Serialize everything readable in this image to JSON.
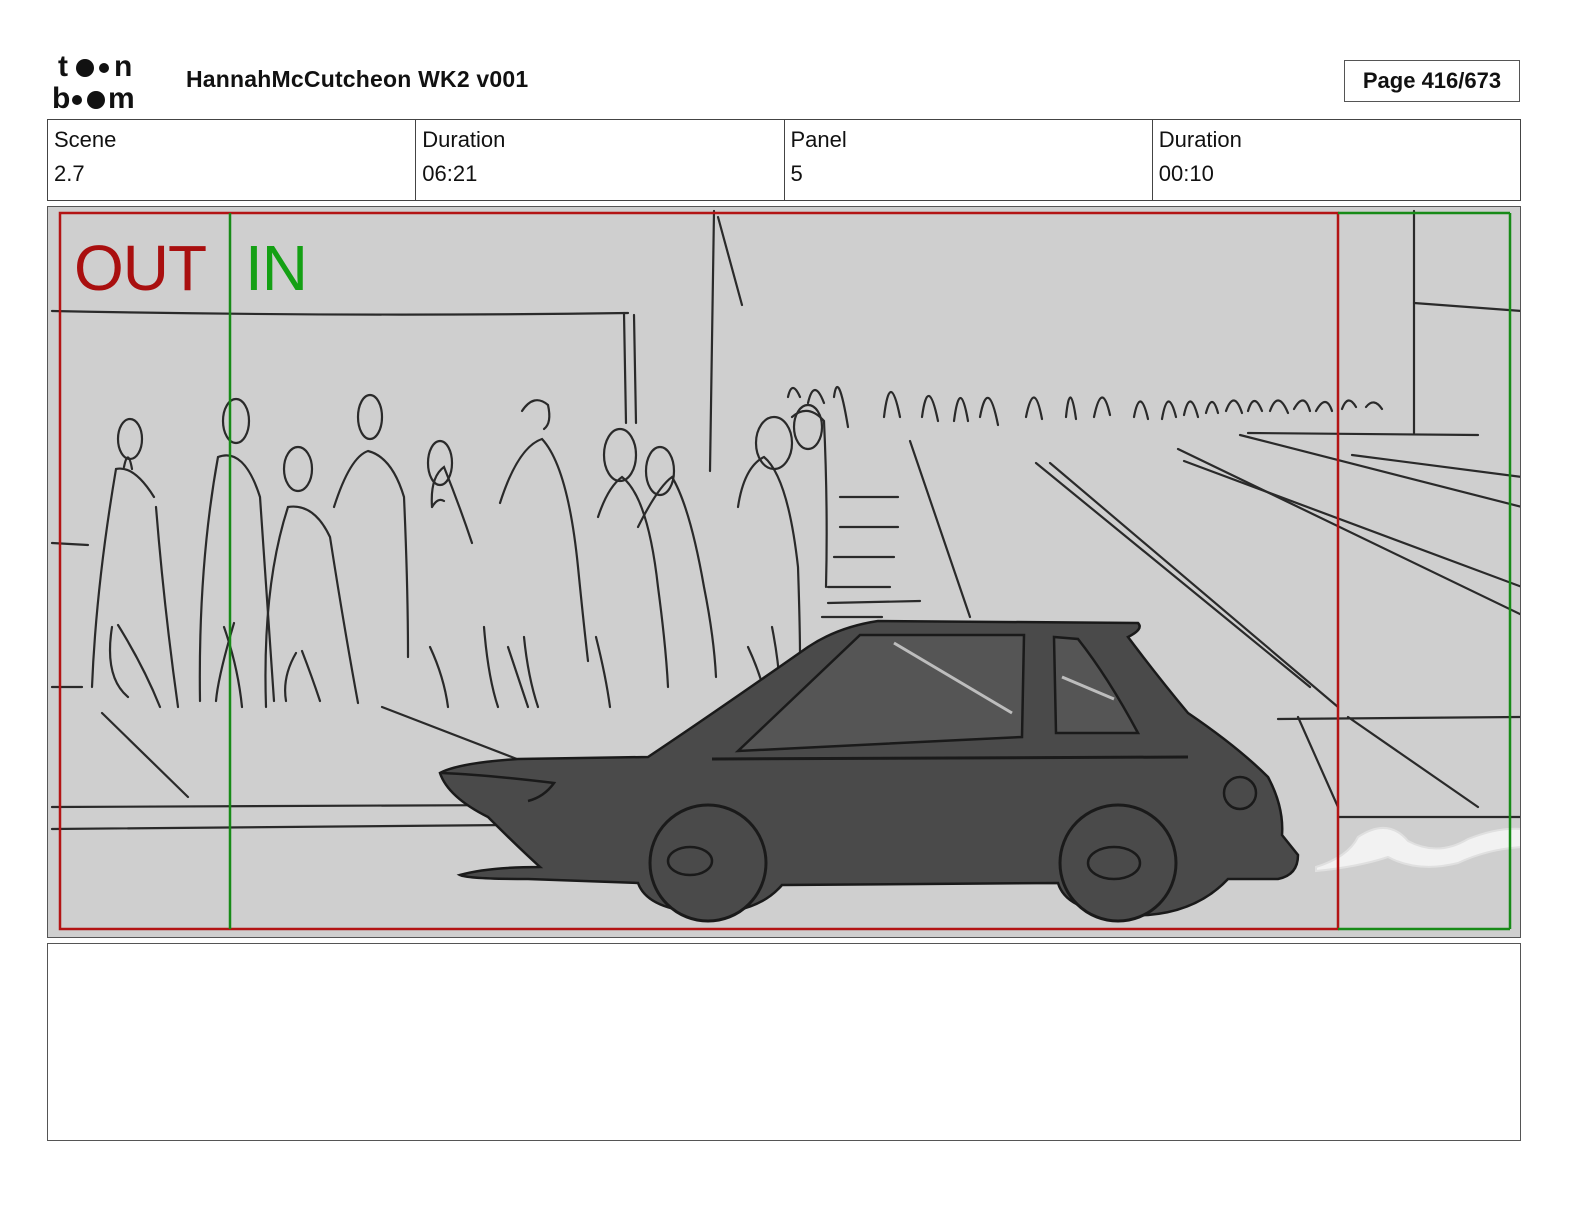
{
  "header": {
    "logo_text": "toon boom",
    "title": "HannahMcCutcheon WK2 v001",
    "page_label": "Page 416/673"
  },
  "info": {
    "scene_label": "Scene",
    "scene_value": "2.7",
    "scene_duration_label": "Duration",
    "scene_duration_value": "06:21",
    "panel_label": "Panel",
    "panel_value": "5",
    "panel_duration_label": "Duration",
    "panel_duration_value": "00:10"
  },
  "panel": {
    "out_label": "OUT",
    "in_label": "IN",
    "out_color": "#a90f0f",
    "in_color": "#14a014"
  },
  "notes": {
    "text": ""
  }
}
